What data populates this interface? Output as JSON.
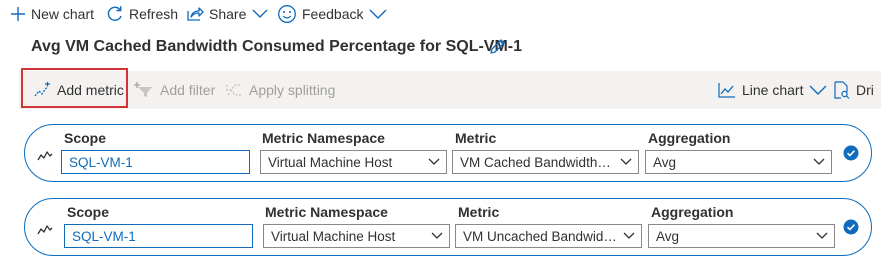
{
  "command_bar": {
    "new_chart": "New chart",
    "refresh": "Refresh",
    "share": "Share",
    "feedback": "Feedback"
  },
  "chart_title": "Avg VM Cached Bandwidth Consumed Percentage for SQL-VM-1",
  "toolbar": {
    "add_metric": "Add metric",
    "add_filter": "Add filter",
    "apply_splitting": "Apply splitting",
    "line_chart": "Line chart",
    "drill": "Dri"
  },
  "metric_rows": [
    {
      "scope_label": "Scope",
      "scope_value": "SQL-VM-1",
      "namespace_label": "Metric Namespace",
      "namespace_value": "Virtual Machine Host",
      "metric_label": "Metric",
      "metric_value": "VM Cached Bandwidth Consumed Percentage",
      "aggregation_label": "Aggregation",
      "aggregation_value": "Avg"
    },
    {
      "scope_label": "Scope",
      "scope_value": "SQL-VM-1",
      "namespace_label": "Metric Namespace",
      "namespace_value": "Virtual Machine Host",
      "metric_label": "Metric",
      "metric_value": "VM Uncached Bandwidth Consumed Percentage",
      "aggregation_label": "Aggregation",
      "aggregation_value": "Avg"
    }
  ],
  "colors": {
    "accent": "#0f6cbd",
    "highlight_box": "#d13438",
    "toolbar_bg": "#f3f2f1",
    "disabled_text": "#a19f9d"
  }
}
